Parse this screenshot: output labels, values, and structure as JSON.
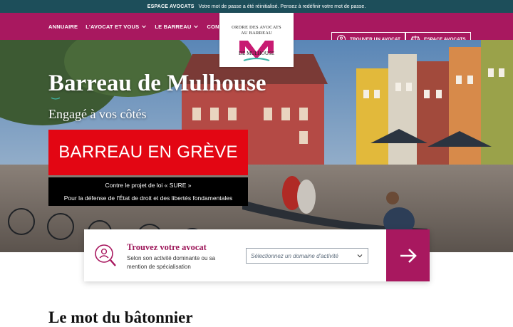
{
  "notice": {
    "title": "ESPACE AVOCATS",
    "message": "Votre mot de passe a été réinitialisé. Pensez à redéfinir votre mot de passe."
  },
  "nav": {
    "items": [
      {
        "label": "ANNUAIRE"
      },
      {
        "label": "L'AVOCAT ET VOUS",
        "dropdown": true
      },
      {
        "label": "LE BARREAU",
        "dropdown": true
      },
      {
        "label": "CONTACT"
      }
    ],
    "logo": {
      "line1": "ORDRE DES AVOCATS",
      "line2": "AU BARREAU",
      "line3": "DE MULHOUSE"
    },
    "find_lawyer": {
      "label": "TROUVER UN AVOCAT",
      "icon": "lawyer-search-icon"
    },
    "lawyer_space": {
      "label": "ESPACE AVOCATS",
      "icon": "scales-icon"
    }
  },
  "hero": {
    "title": "Barreau de Mulhouse",
    "subtitle": "Engagé à vos côtés",
    "strike_banner": "BARREAU EN GRÈVE",
    "strike_line1": "Contre le projet de loi « SURE »",
    "strike_line2": "Pour la défense de l'État de droit et des libertés fondamentales"
  },
  "search": {
    "title": "Trouvez votre avocat",
    "description": "Selon son activité dominante ou sa mention de spécialisation",
    "select_placeholder": "Sélectionnez un domaine d'activité",
    "submit_icon": "arrow-right-icon"
  },
  "section": {
    "title": "Le mot du bâtonnier"
  },
  "colors": {
    "brand": "#a8185f",
    "topbar": "#1d4e5a",
    "strike": "#e30613",
    "accent_teal": "#3fb6a8"
  }
}
